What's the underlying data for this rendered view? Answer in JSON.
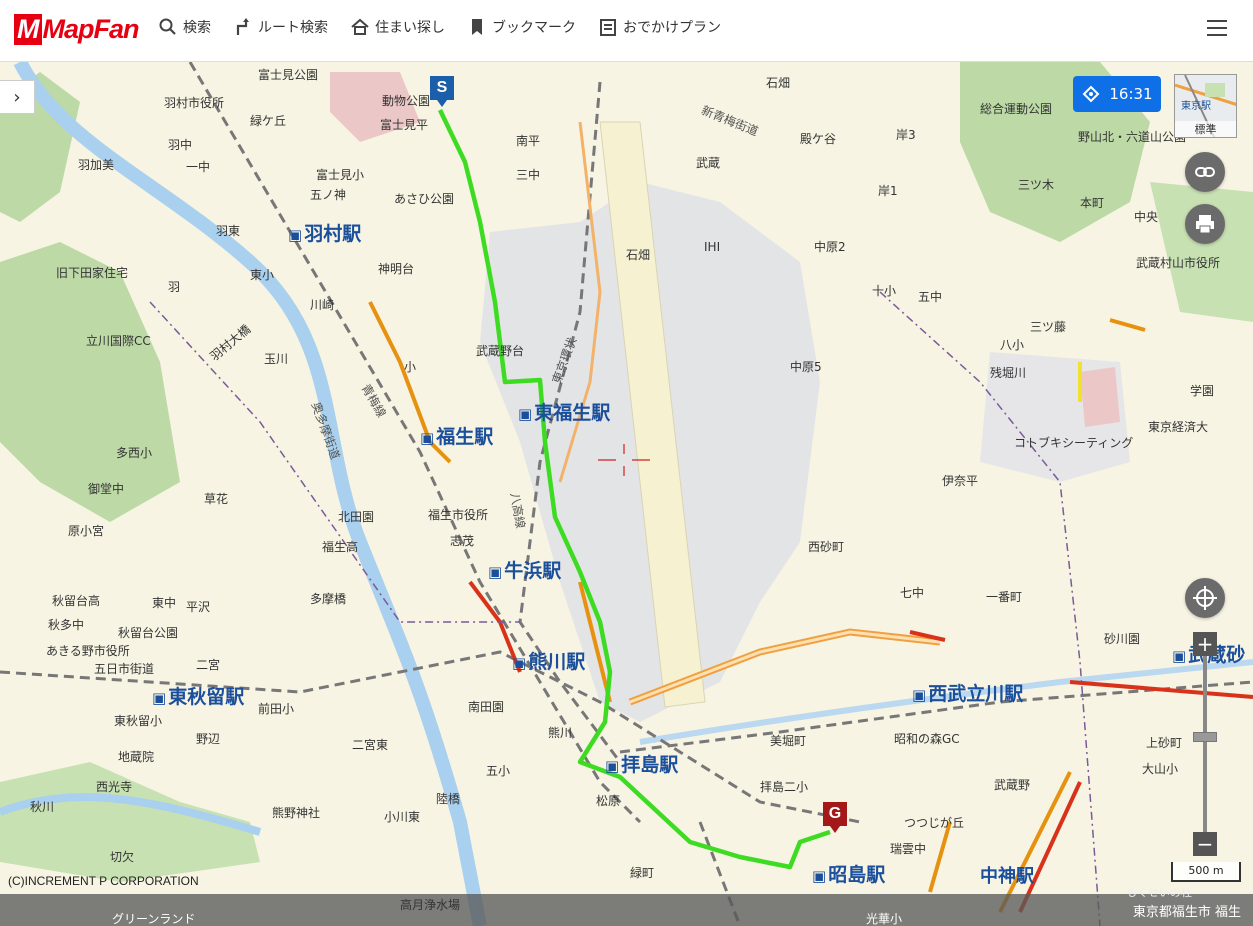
{
  "header": {
    "logo": "MapFan",
    "nav": [
      {
        "label": "検索",
        "icon": "search-icon"
      },
      {
        "label": "ルート検索",
        "icon": "route-icon"
      },
      {
        "label": "住まい探し",
        "icon": "house-icon"
      },
      {
        "label": "ブックマーク",
        "icon": "bookmark-icon"
      },
      {
        "label": "おでかけプラン",
        "icon": "plan-icon"
      }
    ],
    "menu_icon": "hamburger-menu-icon"
  },
  "controls": {
    "side_toggle": "›",
    "time": "16:31",
    "minimap_label": "東京駅",
    "minimap_mode": "標準",
    "zoom_plus": "+",
    "zoom_minus": "−",
    "scale": "500 m"
  },
  "markers": {
    "start": "S",
    "goal": "G"
  },
  "map": {
    "stations": [
      "羽村駅",
      "福生駅",
      "東福生駅",
      "牛浜駅",
      "熊川駅",
      "拝島駅",
      "東秋留駅",
      "西武立川駅",
      "昭島駅",
      "武蔵砂",
      "中神駅"
    ],
    "labels": [
      "富士見公園",
      "羽村市役所",
      "動物公園",
      "富士見平",
      "緑ケ丘",
      "羽中",
      "羽加美",
      "一中",
      "富士見小",
      "五ノ神",
      "あさひ公園",
      "羽東",
      "神明台",
      "東小",
      "川崎",
      "旧下田家住宅",
      "羽",
      "立川国際CC",
      "羽村大橋",
      "玉川",
      "小",
      "武蔵野台",
      "多西小",
      "御堂中",
      "草花",
      "北田園",
      "原小宮",
      "福生高",
      "志茂",
      "福生市役所",
      "秋留台高",
      "東中",
      "平沢",
      "秋多中",
      "秋留台公園",
      "あきる野市役所",
      "五日市街道",
      "二宮",
      "多摩橋",
      "南田園",
      "前田小",
      "東秋留小",
      "野辺",
      "地蔵院",
      "西光寺",
      "二宮東",
      "秋川",
      "熊野神社",
      "小川東",
      "切欠",
      "陸橋",
      "高月浄水場",
      "緑町",
      "熊川",
      "五小",
      "松原",
      "グリーンランド",
      "南平",
      "三中",
      "石畑",
      "武蔵",
      "新青梅街道",
      "殿ケ谷",
      "岸1",
      "岸3",
      "総合運動公園",
      "野山北・六道山公園",
      "三ツ木",
      "本町",
      "中央",
      "武蔵村山市役所",
      "中原2",
      "十小",
      "五中",
      "三ツ藤",
      "八小",
      "残堀川",
      "中原5",
      "学園",
      "東京経済大",
      "コトブキシーティング",
      "伊奈平",
      "西砂町",
      "七中",
      "一番町",
      "砂川園",
      "美堀町",
      "昭和の森GC",
      "拝島二小",
      "武蔵野",
      "つつじが丘",
      "瑞雲中",
      "上砂町",
      "大山小",
      "光華小",
      "もくせいの杜",
      "IHI",
      "石畑",
      "八高線",
      "東京環状",
      "青梅線",
      "奥多摩街道"
    ]
  },
  "copyright": "(C)INCREMENT P CORPORATION",
  "address": "東京都福生市 福生",
  "colors": {
    "accent": "#0f6fe6",
    "brand": "#e60012",
    "route": "#3ddc23",
    "station": "#1b4f9c"
  }
}
